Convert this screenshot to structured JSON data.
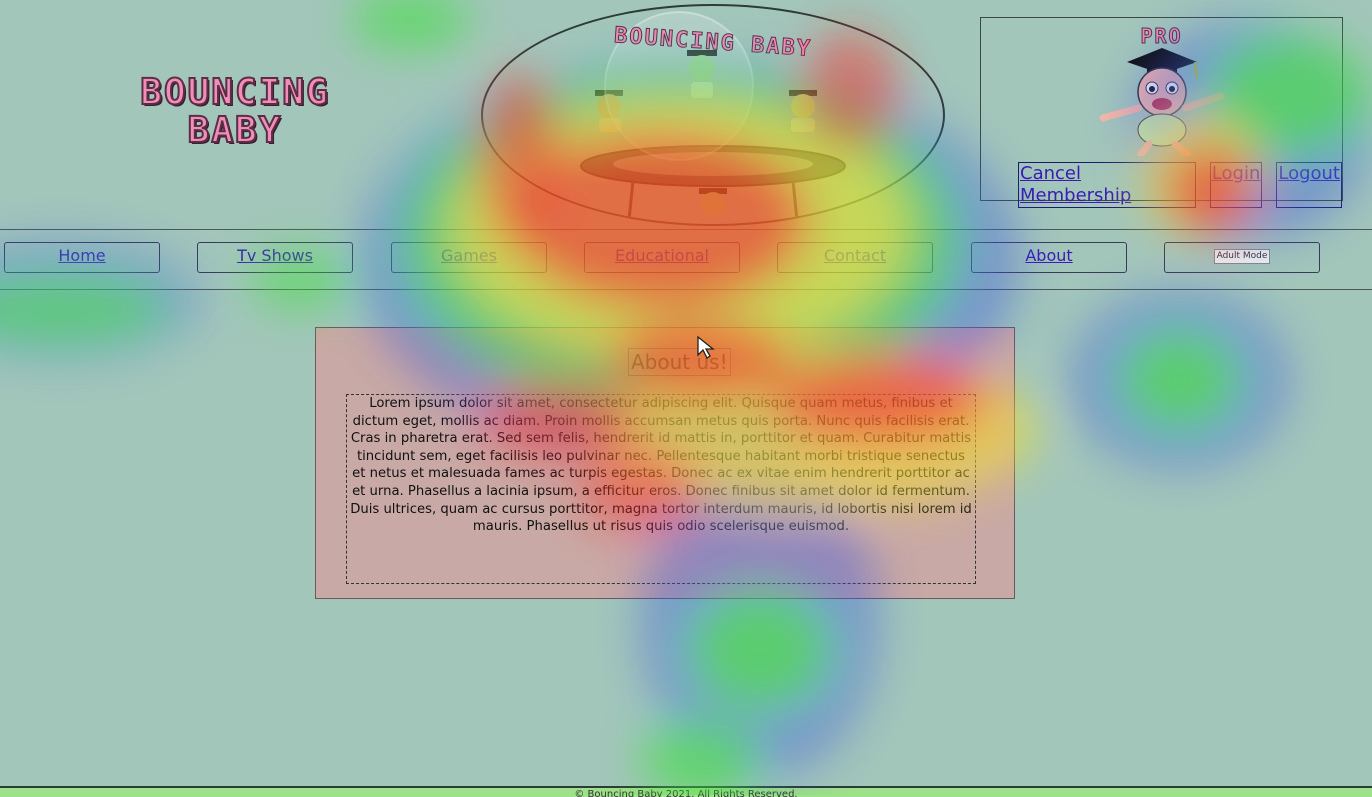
{
  "header": {
    "logo_line1": "BOUNCING",
    "logo_line2": "BABY",
    "hero_title": "BOUNCING BABY"
  },
  "membership": {
    "badge": "PRO",
    "cancel_label": "Cancel Membership",
    "login_label": "Login",
    "logout_label": "Logout"
  },
  "nav": {
    "items": [
      {
        "label": "Home"
      },
      {
        "label": "Tv Shows"
      },
      {
        "label": "Games"
      },
      {
        "label": "Educational"
      },
      {
        "label": "Contact"
      },
      {
        "label": "About"
      }
    ],
    "adult_mode_label": "Adult Mode"
  },
  "main": {
    "title": "About us!",
    "body": "Lorem ipsum dolor sit amet, consectetur adipiscing elit. Quisque quam metus, finibus et dictum eget, mollis ac diam. Proin mollis accumsan metus quis porta. Nunc quis facilisis erat. Cras in pharetra erat. Sed sem felis, hendrerit id mattis in, porttitor et quam. Curabitur mattis tincidunt sem, eget facilisis leo pulvinar nec. Pellentesque habitant morbi tristique senectus et netus et malesuada fames ac turpis egestas. Donec ac ex vitae enim hendrerit porttitor ac et urna. Phasellus a lacinia ipsum, a efficitur eros. Donec finibus sit amet dolor id fermentum. Duis ultrices, quam ac cursus porttitor, magna tortor interdum mauris, id lobortis nisi lorem id mauris. Phasellus ut risus quis odio scelerisque euismod."
  },
  "footer": {
    "text": "© Bouncing Baby 2021. All Rights Reserved."
  },
  "colors": {
    "background": "#a3c6bb",
    "card": "#c9a9a5",
    "link": "#3b1bb3",
    "logo_pink": "#f28cb8"
  }
}
